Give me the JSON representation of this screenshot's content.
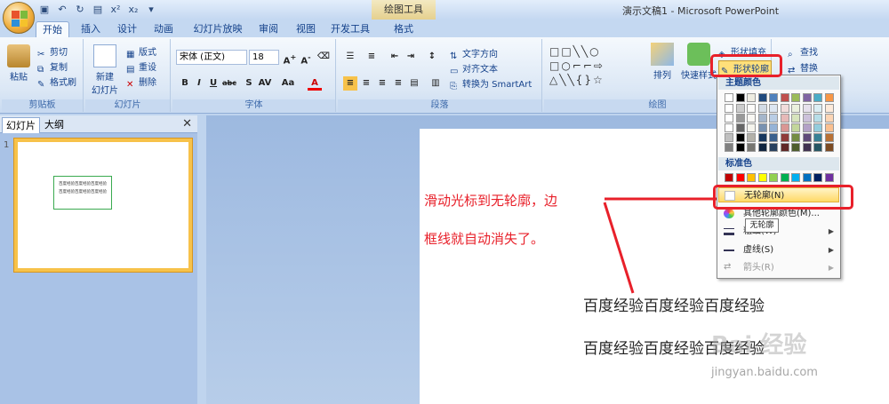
{
  "title_bar": {
    "document_title": "演示文稿1 - Microsoft PowerPoint",
    "context_tab": "绘图工具"
  },
  "tabs": [
    "开始",
    "插入",
    "设计",
    "动画",
    "幻灯片放映",
    "审阅",
    "视图",
    "开发工具",
    "格式"
  ],
  "ribbon": {
    "clipboard": {
      "paste": "粘贴",
      "cut": "剪切",
      "copy": "复制",
      "format_painter": "格式刷",
      "label": "剪贴板"
    },
    "slides": {
      "new_slide_1": "新建",
      "new_slide_2": "幻灯片",
      "layout": "版式",
      "reset": "重设",
      "delete": "删除",
      "label": "幻灯片"
    },
    "font": {
      "font_name": "宋体 (正文)",
      "font_size": "18",
      "label": "字体"
    },
    "paragraph": {
      "text_direction": "文字方向",
      "align_text": "对齐文本",
      "convert_smartart": "转换为 SmartArt",
      "label": "段落"
    },
    "drawing": {
      "arrange": "排列",
      "quick_styles": "快速样式",
      "shape_fill": "形状填充",
      "shape_outline": "形状轮廓",
      "label": "绘图"
    },
    "editing": {
      "find": "查找",
      "replace": "替换"
    }
  },
  "left_pane": {
    "tab_slides": "幻灯片",
    "tab_outline": "大纲",
    "slide_number": "1",
    "thumb_line": "百度经验百度经验百度经验"
  },
  "dropdown": {
    "theme_colors_label": "主题颜色",
    "standard_colors_label": "标准色",
    "no_outline": "无轮廓(N)",
    "more_colors": "其他轮廓颜色(M)...",
    "weight": "粗细(W)",
    "dashes": "虚线(S)",
    "arrows": "箭头(R)",
    "tooltip": "无轮廓",
    "theme_row": [
      "#ffffff",
      "#000000",
      "#eeece1",
      "#1f497d",
      "#4f81bd",
      "#c0504d",
      "#9bbb59",
      "#8064a2",
      "#4bacc6",
      "#f79646"
    ],
    "standard_row": [
      "#c00000",
      "#ff0000",
      "#ffc000",
      "#ffff00",
      "#92d050",
      "#00b050",
      "#00b0f0",
      "#0070c0",
      "#002060",
      "#7030a0"
    ]
  },
  "slide": {
    "line1": "百度经验百度经验百度经验",
    "line2": "百度经验百度经验百度经验"
  },
  "annotation": {
    "line1": "滑动光标到无轮廓，边",
    "line2": "框线就自动消失了。"
  },
  "watermark": {
    "logo": "Bai 经验",
    "url": "jingyan.baidu.com"
  }
}
